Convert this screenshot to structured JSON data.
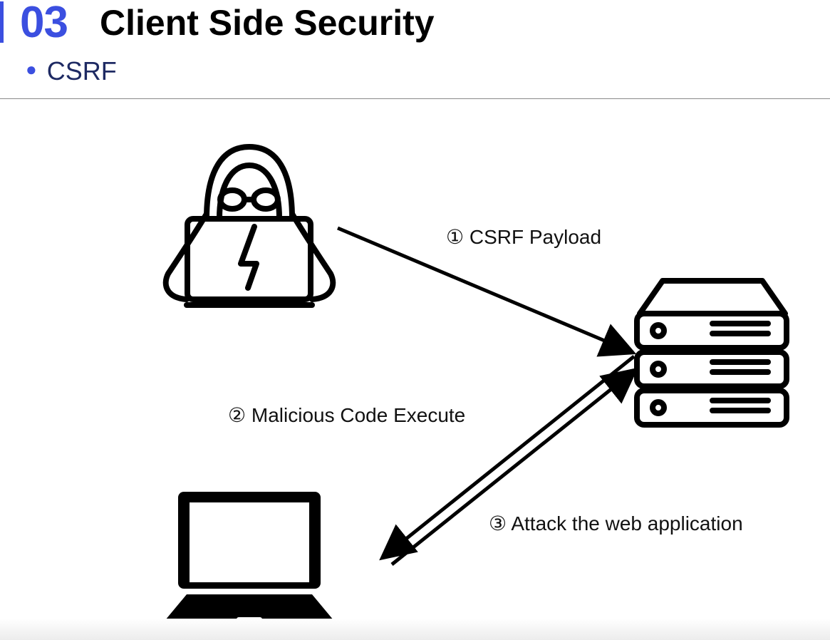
{
  "header": {
    "section_number": "03",
    "title": "Client Side Security",
    "subtitle": "CSRF",
    "accent_color": "#3b4fe0"
  },
  "diagram": {
    "nodes": [
      {
        "id": "attacker",
        "icon": "hacker-icon"
      },
      {
        "id": "server",
        "icon": "server-icon"
      },
      {
        "id": "victim",
        "icon": "laptop-icon"
      }
    ],
    "steps": [
      {
        "label": "① CSRF Payload",
        "from": "attacker",
        "to": "server"
      },
      {
        "label": "② Malicious Code Execute",
        "from": "server",
        "to": "victim"
      },
      {
        "label": "③ Attack the web application",
        "from": "victim",
        "to": "server"
      }
    ]
  }
}
